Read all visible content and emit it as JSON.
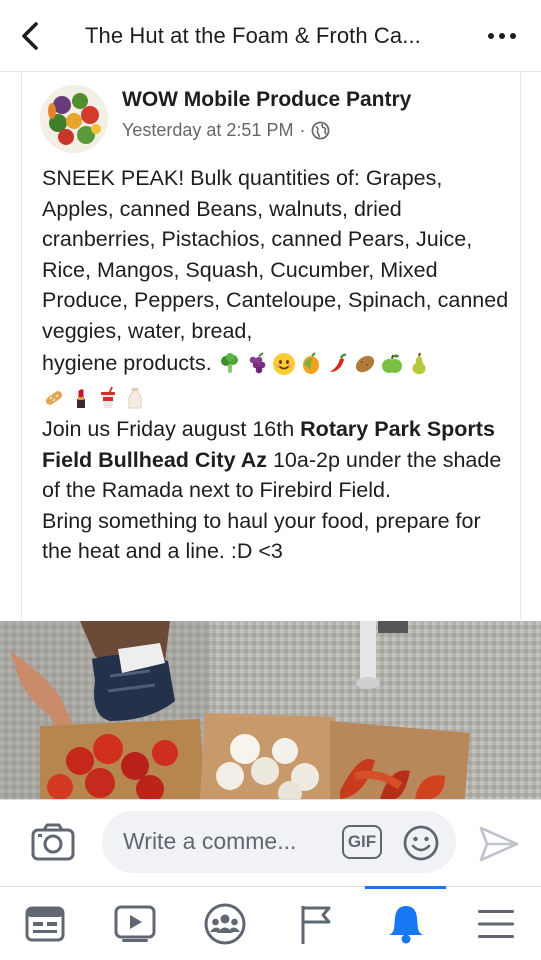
{
  "header": {
    "title": "The Hut at the Foam & Froth Ca...",
    "back_icon": "chevron-left-icon",
    "more_icon": "more-horizontal-icon"
  },
  "post": {
    "author": "WOW Mobile Produce Pantry",
    "timestamp": "Yesterday at 2:51 PM",
    "separator": "·",
    "privacy_icon": "globe-icon",
    "paragraph1": "SNEEK PEAK!  Bulk quantities of:  Grapes, Apples, canned Beans, walnuts, dried cranberries, Pistachios, canned Pears, Juice, Rice, Mangos, Squash, Cucumber, Mixed Produce, Peppers, Canteloupe, Spinach, canned veggies, water, bread,",
    "paragraph1_tail": "hygiene products.",
    "emojis": [
      "broccoli",
      "grapes",
      "smiling-face",
      "mango",
      "hot-pepper",
      "potato",
      "green-apple",
      "pear",
      "bread",
      "lipstick",
      "cup-with-straw",
      "milk-bottle"
    ],
    "paragraph2_a": "Join us Friday august 16th ",
    "paragraph2_bold": "Rotary Park Sports Field Bullhead City Az",
    "paragraph2_b": " 10a-2p under the shade of the Ramada next to Firebird Field.",
    "paragraph3": "Bring something to haul your food, prepare for the heat and a line.  :D <3"
  },
  "comment_bar": {
    "placeholder": "Write a comme...",
    "gif_label": "GIF",
    "camera_icon": "camera-icon",
    "emoji_icon": "smiley-icon",
    "send_icon": "send-icon"
  },
  "tabbar": {
    "tabs": [
      {
        "name": "news-feed",
        "icon": "news-feed-icon"
      },
      {
        "name": "watch",
        "icon": "video-icon"
      },
      {
        "name": "groups",
        "icon": "groups-icon"
      },
      {
        "name": "pages",
        "icon": "flag-icon"
      },
      {
        "name": "notifications",
        "icon": "bell-icon",
        "active": true
      },
      {
        "name": "menu",
        "icon": "hamburger-icon"
      }
    ],
    "active_color": "#1877f2"
  }
}
